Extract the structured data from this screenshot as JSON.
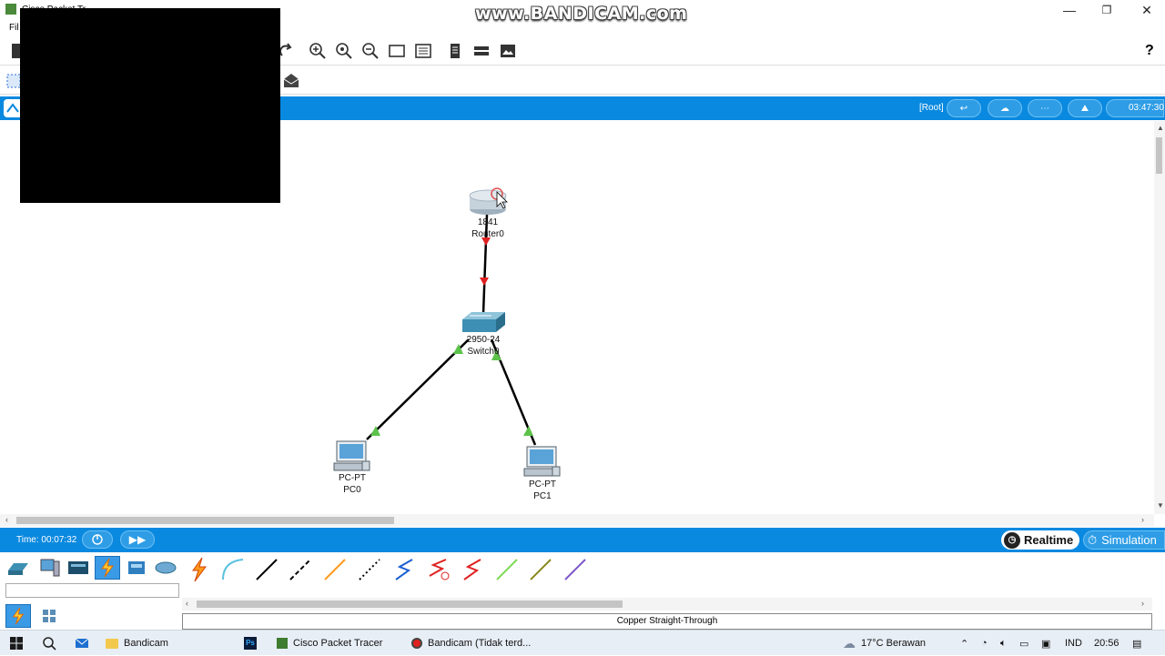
{
  "window": {
    "title": "Cisco Packet Tr",
    "watermark": "www.BANDICAM.com",
    "menu_file": "Fil",
    "controls": [
      "—",
      "❐",
      "✕"
    ],
    "help": "?"
  },
  "logical_bar": {
    "root": "[Root]",
    "clock": "03:47:30"
  },
  "devices": {
    "router": {
      "model": "1841",
      "name": "Router0"
    },
    "switch": {
      "model": "2950-24",
      "name": "Switch0"
    },
    "pc0": {
      "model": "PC-PT",
      "name": "PC0"
    },
    "pc1": {
      "model": "PC-PT",
      "name": "PC1"
    }
  },
  "status": {
    "time": "Time: 00:07:32",
    "realtime": "Realtime",
    "simulation": "Simulation"
  },
  "cables": {
    "selected_name": "Copper Straight-Through",
    "items": [
      "auto-connect-icon",
      "console-cable-icon",
      "copper-straight-icon",
      "copper-cross-icon",
      "fiber-icon",
      "phone-cable-icon",
      "coaxial-icon",
      "serial-dce-icon",
      "serial-dte-icon",
      "octal-icon",
      "iot-cable-icon",
      "usb-cable-icon"
    ]
  },
  "taskbar": {
    "apps": [
      {
        "label": "Bandicam",
        "icon": "folder-icon"
      },
      {
        "label": "",
        "icon": "photoshop-icon"
      },
      {
        "label": "Cisco Packet Tracer",
        "icon": "packet-tracer-icon"
      },
      {
        "label": "Bandicam (Tidak terd...",
        "icon": "bandicam-record-icon"
      }
    ],
    "weather": "17°C  Berawan",
    "language": "IND",
    "time": "20:56"
  },
  "colors": {
    "accent_blue": "#0a89e0",
    "link_down_red": "#e02020",
    "link_up_green": "#5cc24a"
  }
}
